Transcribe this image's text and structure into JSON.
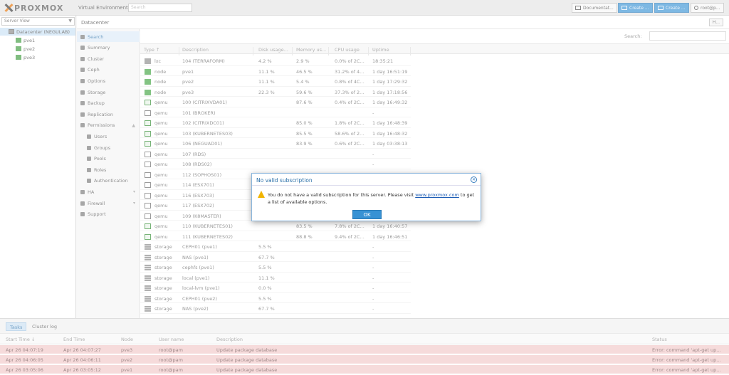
{
  "topbar": {
    "brand": "PROXMOX",
    "version": "Virtual Environment 6.1-8",
    "search_placeholder": "Search",
    "docs_label": "Documentat...",
    "create_vm_label": "Create ...",
    "create_ct_label": "Create ...",
    "user_label": "root@p..."
  },
  "tree": {
    "view_label": "Server View",
    "datacenter_label": "Datacenter (NEGULAB)",
    "nodes": [
      "pve1",
      "pve2",
      "pve3"
    ]
  },
  "breadcrumb": {
    "label": "Datacenter",
    "help_label": "H..."
  },
  "nav": {
    "items": [
      {
        "label": "Search",
        "icon": "search-icon"
      },
      {
        "label": "Summary",
        "icon": "book-icon"
      },
      {
        "label": "Cluster",
        "icon": "server-icon"
      },
      {
        "label": "Ceph",
        "icon": "ceph-icon"
      },
      {
        "label": "Options",
        "icon": "gear-icon"
      },
      {
        "label": "Storage",
        "icon": "database-icon"
      },
      {
        "label": "Backup",
        "icon": "floppy-icon"
      },
      {
        "label": "Replication",
        "icon": "retweet-icon"
      },
      {
        "label": "Permissions",
        "icon": "unlock-icon"
      },
      {
        "label": "Users",
        "icon": "user-icon"
      },
      {
        "label": "Groups",
        "icon": "users-icon"
      },
      {
        "label": "Pools",
        "icon": "tags-icon"
      },
      {
        "label": "Roles",
        "icon": "male-icon"
      },
      {
        "label": "Authentication",
        "icon": "key-icon"
      },
      {
        "label": "HA",
        "icon": "heartbeat-icon"
      },
      {
        "label": "Firewall",
        "icon": "shield-icon"
      },
      {
        "label": "Support",
        "icon": "comments-icon"
      }
    ]
  },
  "grid": {
    "search_label": "Search:",
    "columns": [
      "Type ↑",
      "Description",
      "Disk usage...",
      "Memory us...",
      "CPU usage",
      "Uptime"
    ],
    "rows": [
      {
        "type": "lxc",
        "desc": "104 (TERRAFORM)",
        "disk": "4.2 %",
        "mem": "2.9 %",
        "cpu": "0.0% of 2C...",
        "uptime": "18:35:21"
      },
      {
        "type": "node",
        "desc": "pve1",
        "disk": "11.1 %",
        "mem": "46.5 %",
        "cpu": "31.2% of 4...",
        "uptime": "1 day 16:51:19"
      },
      {
        "type": "node",
        "desc": "pve2",
        "disk": "11.1 %",
        "mem": "5.4 %",
        "cpu": "0.8% of 4C...",
        "uptime": "1 day 17:29:32"
      },
      {
        "type": "node",
        "desc": "pve3",
        "disk": "22.3 %",
        "mem": "59.6 %",
        "cpu": "37.3% of 2...",
        "uptime": "1 day 17:18:56"
      },
      {
        "type": "qemu",
        "desc": "100 (CITRIXVDA01)",
        "disk": "",
        "mem": "87.6 %",
        "cpu": "0.4% of 2C...",
        "uptime": "1 day 16:49:32"
      },
      {
        "type": "qemu",
        "desc": "101 (BROKER)",
        "disk": "",
        "mem": "",
        "cpu": "",
        "uptime": "-"
      },
      {
        "type": "qemu",
        "desc": "102 (CITRIXDC01)",
        "disk": "",
        "mem": "85.0 %",
        "cpu": "1.8% of 2C...",
        "uptime": "1 day 16:48:39"
      },
      {
        "type": "qemu",
        "desc": "103 (KUBERNETES03)",
        "disk": "",
        "mem": "85.5 %",
        "cpu": "58.6% of 2...",
        "uptime": "1 day 16:48:32"
      },
      {
        "type": "qemu",
        "desc": "106 (NEGUAD01)",
        "disk": "",
        "mem": "83.9 %",
        "cpu": "0.6% of 2C...",
        "uptime": "1 day 03:38:13"
      },
      {
        "type": "qemu",
        "desc": "107 (RDS)",
        "disk": "",
        "mem": "",
        "cpu": "",
        "uptime": "-"
      },
      {
        "type": "qemu",
        "desc": "108 (RDS02)",
        "disk": "",
        "mem": "",
        "cpu": "",
        "uptime": "-"
      },
      {
        "type": "qemu",
        "desc": "112 (SOPHOS01)",
        "disk": "",
        "mem": "",
        "cpu": "",
        "uptime": ""
      },
      {
        "type": "qemu",
        "desc": "114 (ESX701)",
        "disk": "",
        "mem": "",
        "cpu": "",
        "uptime": ""
      },
      {
        "type": "qemu",
        "desc": "116 (ESX703)",
        "disk": "",
        "mem": "",
        "cpu": "",
        "uptime": ""
      },
      {
        "type": "qemu",
        "desc": "117 (ESX702)",
        "disk": "",
        "mem": "",
        "cpu": "",
        "uptime": ""
      },
      {
        "type": "qemu",
        "desc": "109 (K8MASTER)",
        "disk": "",
        "mem": "",
        "cpu": "",
        "uptime": ""
      },
      {
        "type": "qemu",
        "desc": "110 (KUBERNETES01)",
        "disk": "",
        "mem": "83.5 %",
        "cpu": "7.8% of 2C...",
        "uptime": "1 day 16:40:57"
      },
      {
        "type": "qemu",
        "desc": "111 (KUBERNETES02)",
        "disk": "",
        "mem": "88.8 %",
        "cpu": "9.4% of 2C...",
        "uptime": "1 day 16:46:51"
      },
      {
        "type": "storage",
        "desc": "CEPH01 (pve1)",
        "disk": "5.5 %",
        "mem": "",
        "cpu": "",
        "uptime": "-"
      },
      {
        "type": "storage",
        "desc": "NAS (pve1)",
        "disk": "67.7 %",
        "mem": "",
        "cpu": "",
        "uptime": "-"
      },
      {
        "type": "storage",
        "desc": "cephfs (pve1)",
        "disk": "5.5 %",
        "mem": "",
        "cpu": "",
        "uptime": "-"
      },
      {
        "type": "storage",
        "desc": "local (pve1)",
        "disk": "11.1 %",
        "mem": "",
        "cpu": "",
        "uptime": "-"
      },
      {
        "type": "storage",
        "desc": "local-lvm (pve1)",
        "disk": "0.0 %",
        "mem": "",
        "cpu": "",
        "uptime": "-"
      },
      {
        "type": "storage",
        "desc": "CEPH01 (pve2)",
        "disk": "5.5 %",
        "mem": "",
        "cpu": "",
        "uptime": "-"
      },
      {
        "type": "storage",
        "desc": "NAS (pve2)",
        "disk": "67.7 %",
        "mem": "",
        "cpu": "",
        "uptime": "-"
      }
    ]
  },
  "tasks": {
    "tab_tasks": "Tasks",
    "tab_cluster_log": "Cluster log",
    "columns": [
      "Start Time ↓",
      "End Time",
      "Node",
      "User name",
      "Description",
      "Status"
    ],
    "rows": [
      {
        "start": "Apr 26 04:07:19",
        "end": "Apr 26 04:07:27",
        "node": "pve3",
        "user": "root@pam",
        "desc": "Update package database",
        "status": "Error: command 'apt-get up..."
      },
      {
        "start": "Apr 26 04:06:05",
        "end": "Apr 26 04:06:11",
        "node": "pve2",
        "user": "root@pam",
        "desc": "Update package database",
        "status": "Error: command 'apt-get up..."
      },
      {
        "start": "Apr 26 03:05:06",
        "end": "Apr 26 03:05:12",
        "node": "pve1",
        "user": "root@pam",
        "desc": "Update package database",
        "status": "Error: command 'apt-get up..."
      }
    ]
  },
  "modal": {
    "title": "No valid subscription",
    "message_before": "You do not have a valid subscription for this server. Please visit ",
    "link": "www.proxmox.com",
    "message_after": " to get a list of available options.",
    "ok_label": "OK"
  }
}
